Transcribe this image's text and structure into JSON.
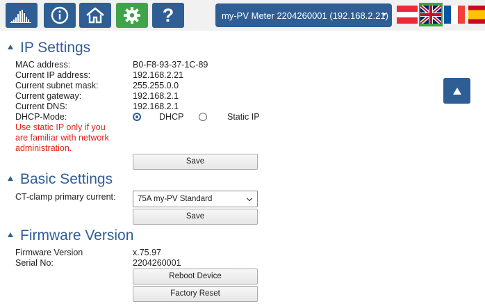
{
  "nav": {
    "items": [
      {
        "name": "chart"
      },
      {
        "name": "info"
      },
      {
        "name": "home"
      },
      {
        "name": "settings",
        "active": true
      },
      {
        "name": "help",
        "text": "?"
      }
    ],
    "device_select": "my-PV Meter 2204260001 (192.168.2.21)",
    "languages": [
      "at",
      "en",
      "fr",
      "es"
    ],
    "selected_language": "en"
  },
  "colors": {
    "primary": "#2f5e95",
    "active": "#3ea447",
    "warning": "#e2211c"
  },
  "ip_settings": {
    "title": "IP Settings",
    "fields": [
      {
        "label": "MAC address:",
        "value": "B0-F8-93-37-1C-89"
      },
      {
        "label": "Current IP address:",
        "value": "192.168.2.21"
      },
      {
        "label": "Current subnet mask:",
        "value": "255.255.0.0"
      },
      {
        "label": "Current gateway:",
        "value": "192.168.2.1"
      },
      {
        "label": "Current DNS:",
        "value": "192.168.2.1"
      }
    ],
    "dhcp_label": "DHCP-Mode:",
    "dhcp_option": "DHCP",
    "static_option": "Static IP",
    "selected_mode": "DHCP",
    "warning": "Use static IP only if you are familiar with network administration.",
    "save_label": "Save"
  },
  "basic_settings": {
    "title": "Basic Settings",
    "ct_label": "CT-clamp primary current:",
    "ct_value": "75A my-PV Standard",
    "save_label": "Save"
  },
  "firmware": {
    "title": "Firmware Version",
    "version_label": "Firmware Version",
    "version_value": "x.75.97",
    "serial_label": "Serial No:",
    "serial_value": "2204260001",
    "reboot_label": "Reboot Device",
    "reset_label": "Factory Reset"
  }
}
